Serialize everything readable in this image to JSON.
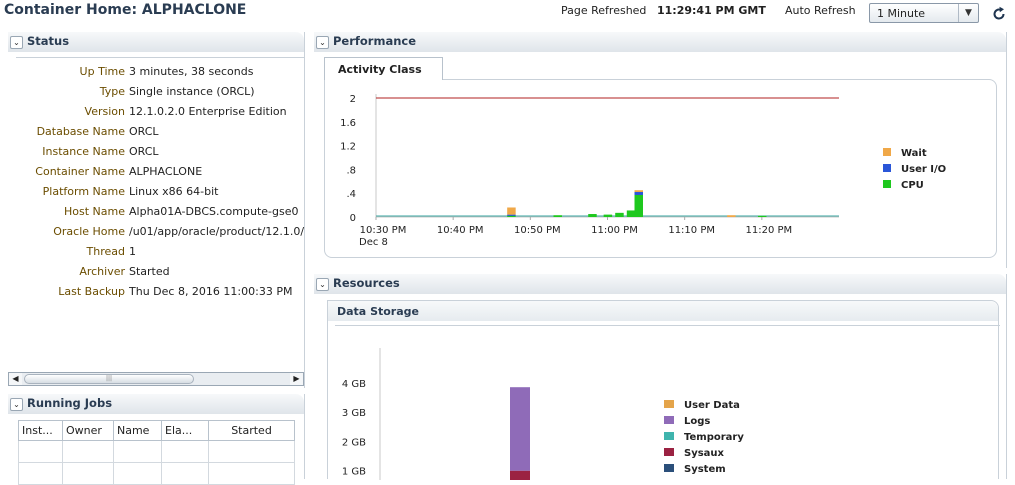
{
  "page": {
    "title": "Container Home: ALPHACLONE",
    "refreshed_label": "Page Refreshed",
    "refreshed_time": "11:29:41 PM GMT",
    "auto_refresh_label": "Auto Refresh",
    "auto_refresh_value": "1 Minute"
  },
  "status": {
    "title": "Status",
    "rows": [
      {
        "label": "Up Time",
        "value": "3 minutes, 38 seconds"
      },
      {
        "label": "Type",
        "value": "Single instance (ORCL)"
      },
      {
        "label": "Version",
        "value": "12.1.0.2.0 Enterprise Edition"
      },
      {
        "label": "Database Name",
        "value": "ORCL"
      },
      {
        "label": "Instance Name",
        "value": "ORCL"
      },
      {
        "label": "Container Name",
        "value": "ALPHACLONE"
      },
      {
        "label": "Platform Name",
        "value": "Linux x86 64-bit"
      },
      {
        "label": "Host Name",
        "value": "Alpha01A-DBCS.compute-gse0"
      },
      {
        "label": "Oracle Home",
        "value": "/u01/app/oracle/product/12.1.0/"
      },
      {
        "label": "Thread",
        "value": "1"
      },
      {
        "label": "Archiver",
        "value": "Started"
      },
      {
        "label": "Last Backup",
        "value": "Thu Dec 8, 2016 11:00:33 PM"
      }
    ]
  },
  "jobs": {
    "title": "Running Jobs",
    "columns": [
      "Inst...",
      "Owner",
      "Name",
      "Ela...",
      "Started"
    ]
  },
  "performance": {
    "title": "Performance",
    "tab_label": "Activity Class"
  },
  "resources": {
    "title": "Resources",
    "storage_title": "Data Storage"
  },
  "chart_data": [
    {
      "type": "area",
      "x_labels": [
        "10:30 PM",
        "10:40 PM",
        "10:50 PM",
        "11:00 PM",
        "11:10 PM",
        "11:20 PM"
      ],
      "x_sublabel": "Dec 8",
      "y_ticks": [
        "0",
        ".4",
        ".8",
        "1.2",
        "1.6",
        "2"
      ],
      "ylim": [
        0,
        2
      ],
      "max_line": 2,
      "grid": false,
      "legend_placement": "right",
      "series": [
        {
          "name": "Wait",
          "color": "#f0a848"
        },
        {
          "name": "User I/O",
          "color": "#2a56d8"
        },
        {
          "name": "CPU",
          "color": "#1ec81e"
        }
      ],
      "samples": [
        {
          "minute": 17,
          "wait": 0.12,
          "user_io": 0.02,
          "cpu": 0.02
        },
        {
          "minute": 23,
          "wait": 0.0,
          "user_io": 0.0,
          "cpu": 0.03
        },
        {
          "minute": 27.5,
          "wait": 0.0,
          "user_io": 0.0,
          "cpu": 0.05
        },
        {
          "minute": 29.5,
          "wait": 0.0,
          "user_io": 0.0,
          "cpu": 0.04
        },
        {
          "minute": 31,
          "wait": 0.0,
          "user_io": 0.0,
          "cpu": 0.07
        },
        {
          "minute": 32.5,
          "wait": 0.0,
          "user_io": 0.0,
          "cpu": 0.11
        },
        {
          "minute": 33.5,
          "wait": 0.03,
          "user_io": 0.05,
          "cpu": 0.37
        },
        {
          "minute": 45.5,
          "wait": 0.03,
          "user_io": 0.0,
          "cpu": 0.0
        },
        {
          "minute": 49.5,
          "wait": 0.0,
          "user_io": 0.0,
          "cpu": 0.02
        }
      ]
    },
    {
      "type": "bar",
      "y_ticks": [
        "0 GB",
        "1 GB",
        "2 GB",
        "3 GB",
        "4 GB"
      ],
      "ylim": [
        0,
        4.5
      ],
      "legend_placement": "right",
      "series": [
        {
          "name": "User Data",
          "color": "#e4a44a",
          "value": 0.0
        },
        {
          "name": "Logs",
          "color": "#8f6bb8",
          "value": 2.85
        },
        {
          "name": "Temporary",
          "color": "#3fb4ad",
          "value": 0.0
        },
        {
          "name": "Sysaux",
          "color": "#9b2242",
          "value": 0.6
        },
        {
          "name": "System",
          "color": "#2b4f7a",
          "value": 0.4
        }
      ]
    }
  ]
}
